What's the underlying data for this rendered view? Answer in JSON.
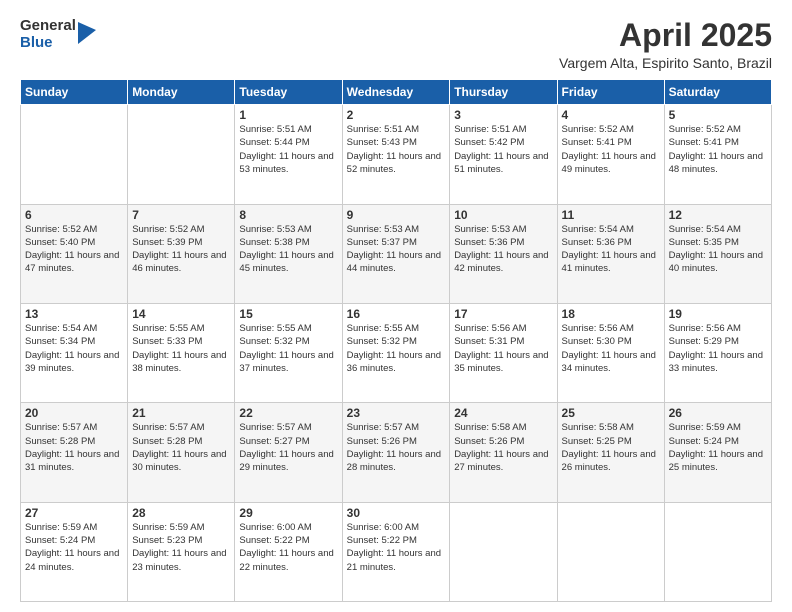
{
  "logo": {
    "general": "General",
    "blue": "Blue"
  },
  "header": {
    "title": "April 2025",
    "location": "Vargem Alta, Espirito Santo, Brazil"
  },
  "weekdays": [
    "Sunday",
    "Monday",
    "Tuesday",
    "Wednesday",
    "Thursday",
    "Friday",
    "Saturday"
  ],
  "weeks": [
    [
      {
        "day": "",
        "info": ""
      },
      {
        "day": "",
        "info": ""
      },
      {
        "day": "1",
        "info": "Sunrise: 5:51 AM\nSunset: 5:44 PM\nDaylight: 11 hours and 53 minutes."
      },
      {
        "day": "2",
        "info": "Sunrise: 5:51 AM\nSunset: 5:43 PM\nDaylight: 11 hours and 52 minutes."
      },
      {
        "day": "3",
        "info": "Sunrise: 5:51 AM\nSunset: 5:42 PM\nDaylight: 11 hours and 51 minutes."
      },
      {
        "day": "4",
        "info": "Sunrise: 5:52 AM\nSunset: 5:41 PM\nDaylight: 11 hours and 49 minutes."
      },
      {
        "day": "5",
        "info": "Sunrise: 5:52 AM\nSunset: 5:41 PM\nDaylight: 11 hours and 48 minutes."
      }
    ],
    [
      {
        "day": "6",
        "info": "Sunrise: 5:52 AM\nSunset: 5:40 PM\nDaylight: 11 hours and 47 minutes."
      },
      {
        "day": "7",
        "info": "Sunrise: 5:52 AM\nSunset: 5:39 PM\nDaylight: 11 hours and 46 minutes."
      },
      {
        "day": "8",
        "info": "Sunrise: 5:53 AM\nSunset: 5:38 PM\nDaylight: 11 hours and 45 minutes."
      },
      {
        "day": "9",
        "info": "Sunrise: 5:53 AM\nSunset: 5:37 PM\nDaylight: 11 hours and 44 minutes."
      },
      {
        "day": "10",
        "info": "Sunrise: 5:53 AM\nSunset: 5:36 PM\nDaylight: 11 hours and 42 minutes."
      },
      {
        "day": "11",
        "info": "Sunrise: 5:54 AM\nSunset: 5:36 PM\nDaylight: 11 hours and 41 minutes."
      },
      {
        "day": "12",
        "info": "Sunrise: 5:54 AM\nSunset: 5:35 PM\nDaylight: 11 hours and 40 minutes."
      }
    ],
    [
      {
        "day": "13",
        "info": "Sunrise: 5:54 AM\nSunset: 5:34 PM\nDaylight: 11 hours and 39 minutes."
      },
      {
        "day": "14",
        "info": "Sunrise: 5:55 AM\nSunset: 5:33 PM\nDaylight: 11 hours and 38 minutes."
      },
      {
        "day": "15",
        "info": "Sunrise: 5:55 AM\nSunset: 5:32 PM\nDaylight: 11 hours and 37 minutes."
      },
      {
        "day": "16",
        "info": "Sunrise: 5:55 AM\nSunset: 5:32 PM\nDaylight: 11 hours and 36 minutes."
      },
      {
        "day": "17",
        "info": "Sunrise: 5:56 AM\nSunset: 5:31 PM\nDaylight: 11 hours and 35 minutes."
      },
      {
        "day": "18",
        "info": "Sunrise: 5:56 AM\nSunset: 5:30 PM\nDaylight: 11 hours and 34 minutes."
      },
      {
        "day": "19",
        "info": "Sunrise: 5:56 AM\nSunset: 5:29 PM\nDaylight: 11 hours and 33 minutes."
      }
    ],
    [
      {
        "day": "20",
        "info": "Sunrise: 5:57 AM\nSunset: 5:28 PM\nDaylight: 11 hours and 31 minutes."
      },
      {
        "day": "21",
        "info": "Sunrise: 5:57 AM\nSunset: 5:28 PM\nDaylight: 11 hours and 30 minutes."
      },
      {
        "day": "22",
        "info": "Sunrise: 5:57 AM\nSunset: 5:27 PM\nDaylight: 11 hours and 29 minutes."
      },
      {
        "day": "23",
        "info": "Sunrise: 5:57 AM\nSunset: 5:26 PM\nDaylight: 11 hours and 28 minutes."
      },
      {
        "day": "24",
        "info": "Sunrise: 5:58 AM\nSunset: 5:26 PM\nDaylight: 11 hours and 27 minutes."
      },
      {
        "day": "25",
        "info": "Sunrise: 5:58 AM\nSunset: 5:25 PM\nDaylight: 11 hours and 26 minutes."
      },
      {
        "day": "26",
        "info": "Sunrise: 5:59 AM\nSunset: 5:24 PM\nDaylight: 11 hours and 25 minutes."
      }
    ],
    [
      {
        "day": "27",
        "info": "Sunrise: 5:59 AM\nSunset: 5:24 PM\nDaylight: 11 hours and 24 minutes."
      },
      {
        "day": "28",
        "info": "Sunrise: 5:59 AM\nSunset: 5:23 PM\nDaylight: 11 hours and 23 minutes."
      },
      {
        "day": "29",
        "info": "Sunrise: 6:00 AM\nSunset: 5:22 PM\nDaylight: 11 hours and 22 minutes."
      },
      {
        "day": "30",
        "info": "Sunrise: 6:00 AM\nSunset: 5:22 PM\nDaylight: 11 hours and 21 minutes."
      },
      {
        "day": "",
        "info": ""
      },
      {
        "day": "",
        "info": ""
      },
      {
        "day": "",
        "info": ""
      }
    ]
  ]
}
